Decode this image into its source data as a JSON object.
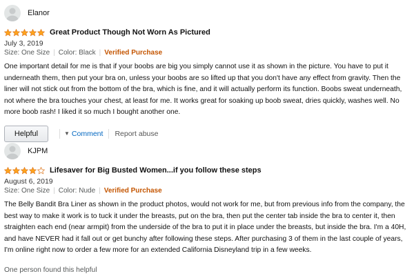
{
  "colors": {
    "star": "#ffa41c",
    "verified": "#c45500",
    "link": "#0066c0"
  },
  "reviews": [
    {
      "profile_name": "Elanor",
      "rating": 5,
      "title": "Great Product Though Not Worn As Pictured",
      "date": "July 3, 2019",
      "size": "Size: One Size",
      "color": "Color: Black",
      "verified": "Verified Purchase",
      "body": "One important detail for me is that if your boobs are big you simply cannot use it as shown in the picture. You have to put it underneath them, then put your bra on, unless your boobs are so lifted up that you don't have any effect from gravity. Then the liner will not stick out from the bottom of the bra, which is fine, and it will actually perform its function. Boobs sweat underneath, not where the bra touches your chest, at least for me. It works great for soaking up boob sweat, dries quickly, washes well. No more boob rash! I liked it so much I bought another one.",
      "helpful_label": "Helpful",
      "comment_label": "Comment",
      "report_label": "Report abuse"
    },
    {
      "profile_name": "KJPM",
      "rating": 4,
      "title": "Lifesaver for Big Busted Women...if you follow these steps",
      "date": "August 6, 2019",
      "size": "Size: One Size",
      "color": "Color: Nude",
      "verified": "Verified Purchase",
      "body": "The Belly Bandit Bra Liner as shown in the product photos, would not work for me, but from previous info from the company, the best way to make it work is to tuck it under the breasts, put on the bra, then put the center tab inside the bra to center it, then straighten each end (near armpit) from the underside of the bra to put it in place under the breasts, but inside the bra. I'm a 40H, and have NEVER had it fall out or get bunchy after following these steps. After purchasing 3 of them in the last couple of years, I'm online right now to order a few more for an extended California Disneyland trip in a few weeks.",
      "found_helpful": "One person found this helpful"
    }
  ]
}
